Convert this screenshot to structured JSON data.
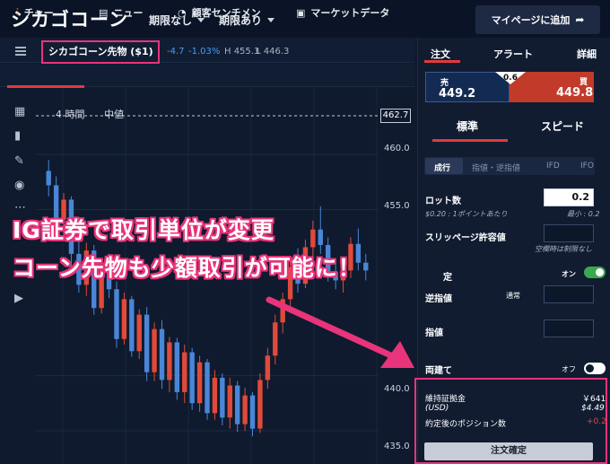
{
  "app": {
    "title": "シカゴコーン",
    "filter_unexpiring": "期限なし",
    "filter_expiring": "期限あり",
    "mypage_button": "マイページに追加"
  },
  "instrument": {
    "name": "シカゴコーン先物 ($1)",
    "change": "-4.7",
    "change_pct": "-1.03%",
    "high": "H 455.3",
    "low": "L 446.3"
  },
  "tabs": [
    "チャー",
    "ニュー",
    "顧客センチメン",
    "マーケットデータ"
  ],
  "chart": {
    "timeframe": "4 時間",
    "price_type": "中値",
    "current_price": "462.7",
    "y_ticks": [
      "460.0",
      "455.0",
      "440.0",
      "435.0"
    ]
  },
  "panel": {
    "tabs": [
      "注文",
      "アラート",
      "詳細"
    ],
    "sell_label": "売",
    "sell_price": "449.2",
    "buy_label": "買",
    "buy_price": "449.8",
    "spread": "0.6",
    "modes": [
      "標準",
      "スピード"
    ],
    "order_types": [
      "成行",
      "指値・逆指値",
      "IFD",
      "IFO"
    ],
    "lot_label": "ロット数",
    "lot_value": "0.2",
    "lot_sub": "$0.20 : 1ポイントあたり",
    "lot_min": "最小 : 0.2",
    "slippage_label": "スリッページ許容値",
    "slippage_sub": "空欄時は制限なし",
    "guarantee_label": "定",
    "guarantee_state": "オン",
    "stop_label": "逆指値",
    "stop_mode": "通常",
    "limit_label": "指値",
    "hedge_label": "両建て",
    "hedge_state": "オフ",
    "margin_label": "維持証拠金",
    "margin_value": "￥641",
    "margin_usd_label": "(USD)",
    "margin_usd_value": "$4.49",
    "position_label": "約定後のポジション数",
    "position_value": "+0.2",
    "confirm_button": "注文確定"
  },
  "banner": {
    "line1": "IG証券で取引単位が変更",
    "line2": "コーン先物も少額取引が可能に！"
  },
  "colors": {
    "up": "#e04a3a",
    "down": "#4a86d8",
    "accent": "#e8347a",
    "bg": "#0f1a2e"
  },
  "chart_data": {
    "type": "candlestick",
    "y_ticks": [
      460,
      455,
      440,
      435
    ],
    "candles": [
      [
        458.5,
        459.5,
        456.2,
        457.2
      ],
      [
        457.2,
        458,
        453.5,
        454.1
      ],
      [
        454.1,
        456.5,
        452.8,
        455.9
      ],
      [
        455.9,
        456.2,
        449.8,
        451
      ],
      [
        451,
        452.5,
        447.5,
        448.2
      ],
      [
        448.2,
        452,
        447.2,
        451.3
      ],
      [
        451.3,
        451.8,
        445.5,
        446.1
      ],
      [
        446.1,
        450.5,
        445.6,
        450
      ],
      [
        450,
        451,
        447,
        447.8
      ],
      [
        447.8,
        448.5,
        442.5,
        443.3
      ],
      [
        443.3,
        447.5,
        442.8,
        446.9
      ],
      [
        446.9,
        447.2,
        441.7,
        442.2
      ],
      [
        442.2,
        446,
        441.5,
        445.5
      ],
      [
        445.5,
        446.2,
        439.5,
        440.3
      ],
      [
        440.3,
        444.8,
        439.5,
        444.2
      ],
      [
        444.2,
        445,
        438.8,
        439.6
      ],
      [
        439.6,
        443.5,
        438.5,
        443
      ],
      [
        443,
        443.4,
        437.8,
        438.5
      ],
      [
        438.5,
        442.8,
        437.5,
        442.1
      ],
      [
        442.1,
        442.5,
        436.9,
        437.5
      ],
      [
        437.5,
        441.8,
        436.7,
        441.2
      ],
      [
        441.2,
        441.5,
        436,
        436.6
      ],
      [
        436.6,
        440.5,
        436,
        439.8
      ],
      [
        439.8,
        440.2,
        435.5,
        436.2
      ],
      [
        436.2,
        439.8,
        435.2,
        439.1
      ],
      [
        439.1,
        439.5,
        434.9,
        435.6
      ],
      [
        435.6,
        438.9,
        435,
        438.2
      ],
      [
        438.2,
        438.5,
        434.5,
        435.2
      ],
      [
        435.2,
        440.2,
        434.8,
        439.6
      ],
      [
        439.6,
        442.5,
        438.8,
        441.8
      ],
      [
        441.8,
        445.5,
        441,
        444.8
      ],
      [
        444.8,
        447.5,
        443.8,
        446.9
      ],
      [
        446.9,
        450.5,
        446,
        449.8
      ],
      [
        449.8,
        451.5,
        447.5,
        448.3
      ],
      [
        448.3,
        452.3,
        447.9,
        451.6
      ],
      [
        451.6,
        454,
        450.6,
        453.2
      ],
      [
        453.2,
        455.3,
        451,
        451.8
      ],
      [
        451.8,
        452.5,
        448.5,
        449.4
      ],
      [
        449.4,
        450.5,
        447.8,
        448.6
      ],
      [
        448.6,
        450.2,
        447.5,
        449.5
      ],
      [
        449.5,
        452.5,
        448.8,
        451.9
      ],
      [
        451.9,
        453.3,
        449.5,
        450.2
      ],
      [
        450.2,
        451,
        448.6,
        449.5
      ]
    ]
  }
}
